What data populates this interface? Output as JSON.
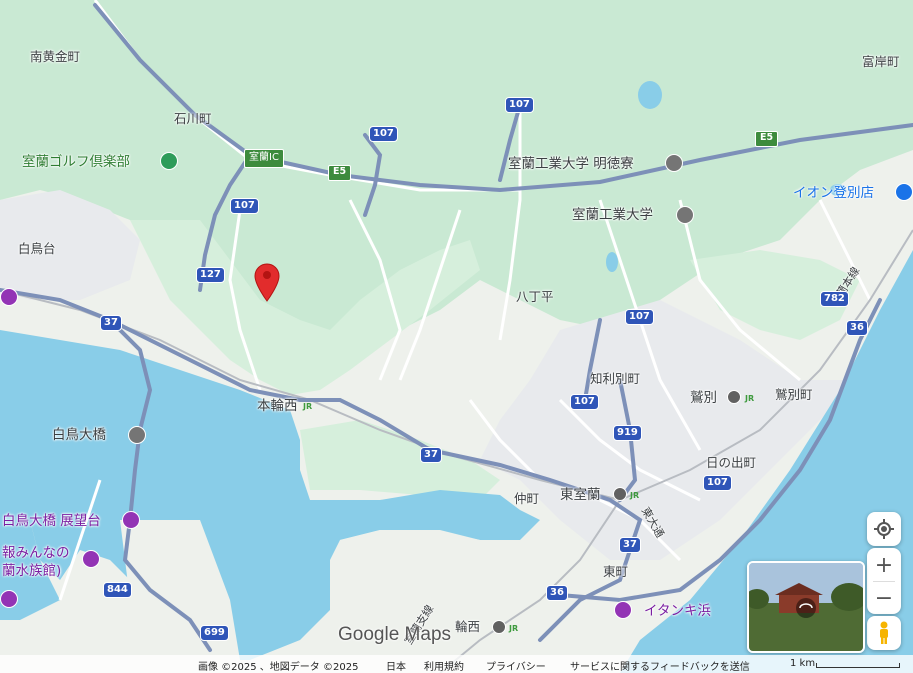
{
  "map": {
    "place_labels": [
      {
        "id": "minami-kogane",
        "text": "南黄金町"
      },
      {
        "id": "ishikawa",
        "text": "石川町"
      },
      {
        "id": "muroran-golf",
        "text": "室蘭ゴルフ倶楽部"
      },
      {
        "id": "hakucho-dai",
        "text": "白鳥台"
      },
      {
        "id": "honwanishi",
        "text": "本輪西"
      },
      {
        "id": "hakucho-ohashi",
        "text": "白鳥大橋"
      },
      {
        "id": "hakucho-observatory",
        "text": "白鳥大橋 展望台"
      },
      {
        "id": "aquarium-1",
        "text": "報みんなの"
      },
      {
        "id": "aquarium-2",
        "text": "蘭水族館)"
      },
      {
        "id": "dormitory",
        "text": "室蘭工業大学 明徳寮"
      },
      {
        "id": "university",
        "text": "室蘭工業大学"
      },
      {
        "id": "hacchodaira",
        "text": "八丁平"
      },
      {
        "id": "chiribetsu",
        "text": "知利別町"
      },
      {
        "id": "washibetsu-station",
        "text": "鷲別"
      },
      {
        "id": "washibetsu-town",
        "text": "鷲別町"
      },
      {
        "id": "hinode",
        "text": "日の出町"
      },
      {
        "id": "nakamachi",
        "text": "仲町"
      },
      {
        "id": "higashi-muroran",
        "text": "東室蘭"
      },
      {
        "id": "higashimachi",
        "text": "東町"
      },
      {
        "id": "itanki",
        "text": "イタンキ浜"
      },
      {
        "id": "wanishi",
        "text": "輪西"
      },
      {
        "id": "aeon",
        "text": "イオン登別店"
      },
      {
        "id": "tomigishi",
        "text": "富岸町"
      },
      {
        "id": "muroran-ic",
        "text": "室蘭IC"
      },
      {
        "id": "muroran-branch-line",
        "text": "室蘭支線"
      },
      {
        "id": "muroran-main-line",
        "text": "室蘭本線"
      },
      {
        "id": "higashi-dori",
        "text": "東大通"
      }
    ],
    "route_shields": [
      "107",
      "107",
      "107",
      "107",
      "107",
      "107",
      "127",
      "37",
      "37",
      "37",
      "36",
      "36",
      "782",
      "919",
      "844",
      "699"
    ],
    "expressway_shields": [
      "E5",
      "E5"
    ],
    "jr_mark": "JR",
    "logo": "Google Maps"
  },
  "controls": {
    "my_location_icon": "my-location-icon",
    "zoom_in": "+",
    "zoom_out": "−",
    "pegman_icon": "pegman-icon"
  },
  "footer": {
    "imagery": "画像 ©2025 、地図データ ©2025",
    "country": "日本",
    "terms": "利用規約",
    "privacy": "プライバシー",
    "feedback": "サービスに関するフィードバックを送信",
    "scale": "1 km"
  },
  "colors": {
    "land": "#eef1ec",
    "forest": "#c9e9d3",
    "water": "#89cde8",
    "highway": "#7d90b8",
    "route_shield": "#2f55b8",
    "expressway": "#3d8b3d",
    "marker": "#e22c2c",
    "poi_purple": "#9334b5"
  }
}
